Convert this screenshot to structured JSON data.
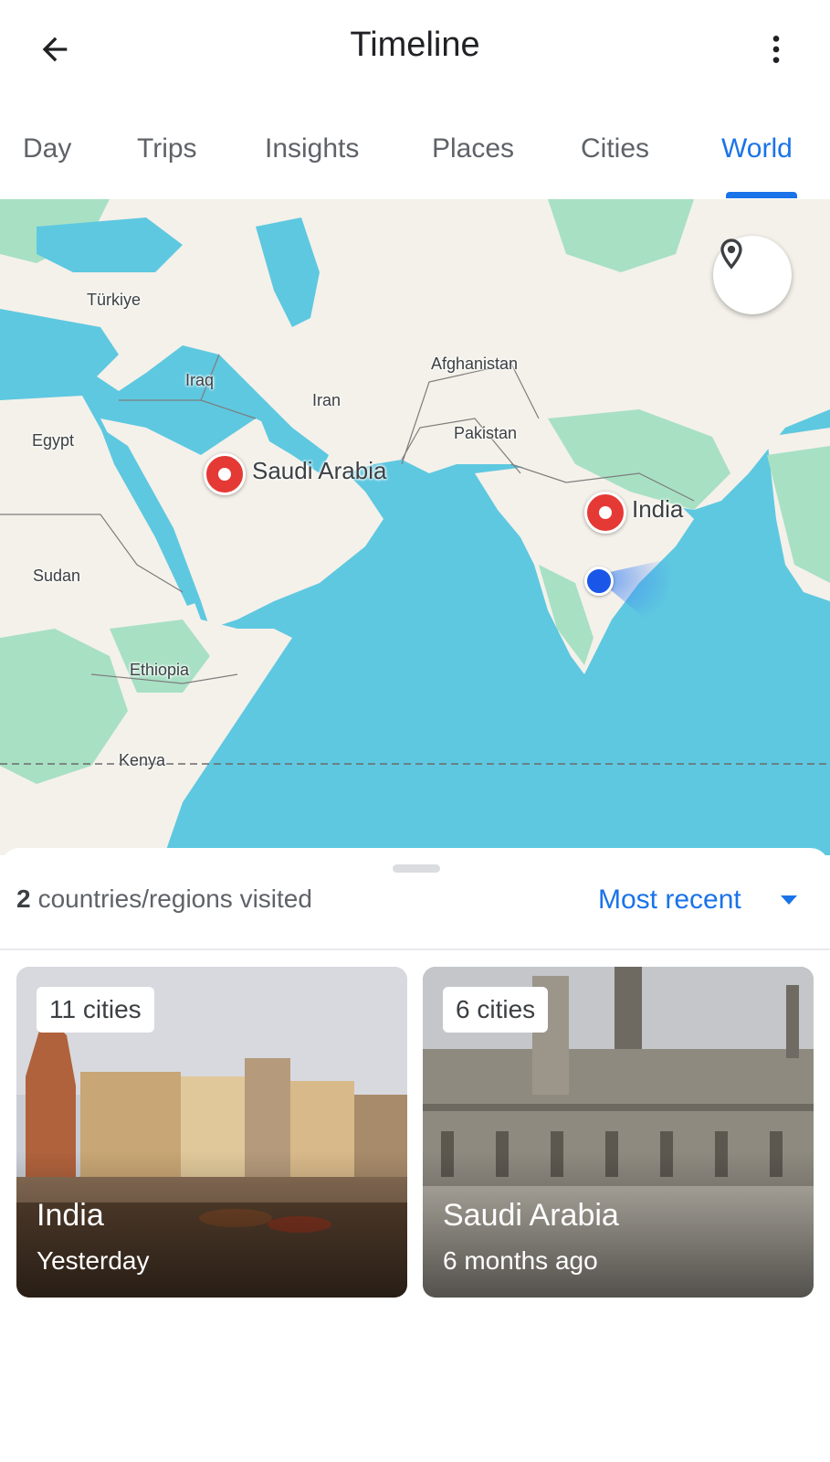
{
  "header": {
    "title": "Timeline",
    "back_icon": "arrow-back-icon",
    "more_icon": "more-vert-icon"
  },
  "tabs": [
    {
      "label": "Day",
      "active": false
    },
    {
      "label": "Trips",
      "active": false
    },
    {
      "label": "Insights",
      "active": false
    },
    {
      "label": "Places",
      "active": false
    },
    {
      "label": "Cities",
      "active": false
    },
    {
      "label": "World",
      "active": true
    }
  ],
  "map": {
    "labels": {
      "turkiye": "Türkiye",
      "iraq": "Iraq",
      "iran": "Iran",
      "afghanistan": "Afghanistan",
      "pakistan": "Pakistan",
      "egypt": "Egypt",
      "sudan": "Sudan",
      "ethiopia": "Ethiopia",
      "kenya": "Kenya",
      "saudi_arabia": "Saudi Arabia",
      "india": "India"
    },
    "location_button_icon": "place-pin-icon",
    "colors": {
      "water": "#5ec8e0",
      "land": "#f4f1ea",
      "vegetation": "#a8e0c4",
      "pin": "#e53935",
      "my_location": "#1a57e8"
    }
  },
  "sheet": {
    "count": "2",
    "summary_text": "countries/regions visited",
    "sort_label": "Most recent",
    "cards": [
      {
        "chip": "11 cities",
        "name": "India",
        "date": "Yesterday"
      },
      {
        "chip": "6 cities",
        "name": "Saudi Arabia",
        "date": "6 months ago"
      }
    ]
  },
  "colors": {
    "accent": "#1a73e8"
  }
}
